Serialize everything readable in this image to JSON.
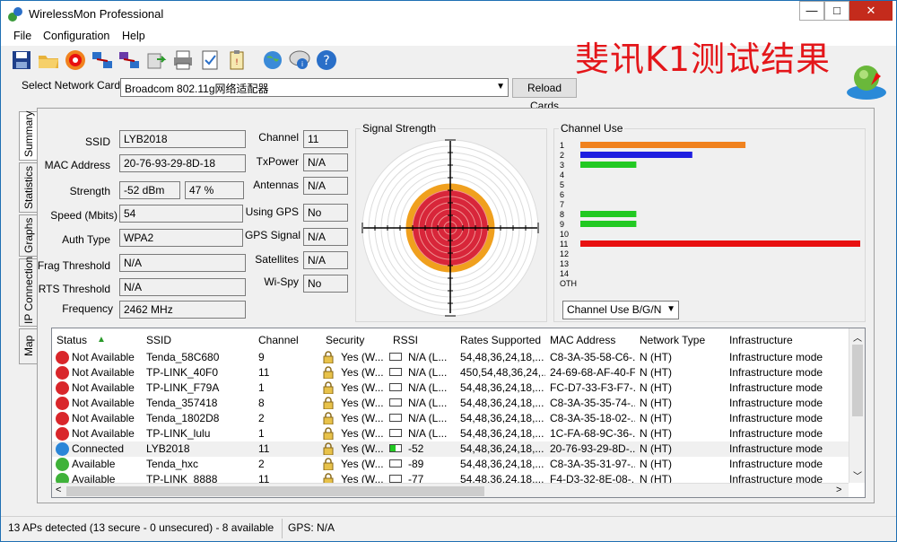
{
  "window": {
    "title": "WirelessMon Professional",
    "min_label": "—",
    "max_label": "□",
    "close_label": "✕"
  },
  "menu": [
    "File",
    "Configuration",
    "Help"
  ],
  "overlay_text": "斐讯K1测试结果",
  "network_card": {
    "label": "Select Network Card",
    "value": "Broadcom 802.11g网络适配器",
    "reload_label": "Reload Cards"
  },
  "tabs": [
    "Summary",
    "Statistics",
    "Graphs",
    "IP Connection",
    "Map"
  ],
  "summary": {
    "ssid_label": "SSID",
    "ssid": "LYB2018",
    "mac_label": "MAC Address",
    "mac": "20-76-93-29-8D-18",
    "strength_label": "Strength",
    "strength_dbm": "-52 dBm",
    "strength_pct": "47 %",
    "speed_label": "Speed (Mbits)",
    "speed": "54",
    "auth_label": "Auth Type",
    "auth": "WPA2",
    "frag_label": "Frag Threshold",
    "frag": "N/A",
    "rts_label": "RTS Threshold",
    "rts": "N/A",
    "freq_label": "Frequency",
    "freq": "2462 MHz",
    "channel_label": "Channel",
    "channel": "11",
    "txpower_label": "TxPower",
    "txpower": "N/A",
    "antennas_label": "Antennas",
    "antennas": "N/A",
    "gps_label": "Using GPS",
    "gps": "No",
    "gps_signal_label": "GPS Signal",
    "gps_signal": "N/A",
    "satellites_label": "Satellites",
    "satellites": "N/A",
    "wispy_label": "Wi-Spy",
    "wispy": "No"
  },
  "signal": {
    "title": "Signal Strength",
    "rings_total": 14,
    "rings_orange": 7,
    "rings_red": 6
  },
  "channel_use": {
    "title": "Channel Use",
    "channels": [
      "1",
      "2",
      "3",
      "4",
      "5",
      "6",
      "7",
      "8",
      "9",
      "10",
      "11",
      "12",
      "13",
      "14",
      "OTH"
    ],
    "bars": [
      {
        "channel": "1",
        "value": 0.59,
        "color": "#f0821e"
      },
      {
        "channel": "2",
        "value": 0.4,
        "color": "#1e1ee0"
      },
      {
        "channel": "3",
        "value": 0.2,
        "color": "#22c922"
      },
      {
        "channel": "8",
        "value": 0.2,
        "color": "#22c922"
      },
      {
        "channel": "9",
        "value": 0.2,
        "color": "#22c922"
      },
      {
        "channel": "11",
        "value": 1.0,
        "color": "#e81010"
      }
    ],
    "dropdown": "Channel Use B/G/N"
  },
  "list": {
    "headers": [
      "Status",
      "SSID",
      "Channel",
      "Security",
      "RSSI",
      "Rates Supported",
      "MAC Address",
      "Network Type",
      "Infrastructure"
    ],
    "rows": [
      {
        "status": "Not Available",
        "color": "#d9262b",
        "ssid": "Tenda_58C680",
        "channel": "9",
        "security": "Yes (W...",
        "rssi": "N/A (L...",
        "rates": "54,48,36,24,18,...",
        "mac": "C8-3A-35-58-C6-...",
        "type": "N (HT)",
        "infra": "Infrastructure mode",
        "sig": 0
      },
      {
        "status": "Not Available",
        "color": "#d9262b",
        "ssid": "TP-LINK_40F0",
        "channel": "11",
        "security": "Yes (W...",
        "rssi": "N/A (L...",
        "rates": "450,54,48,36,24,...",
        "mac": "24-69-68-AF-40-F0",
        "type": "N (HT)",
        "infra": "Infrastructure mode",
        "sig": 0
      },
      {
        "status": "Not Available",
        "color": "#d9262b",
        "ssid": "TP-LINK_F79A",
        "channel": "1",
        "security": "Yes (W...",
        "rssi": "N/A (L...",
        "rates": "54,48,36,24,18,...",
        "mac": "FC-D7-33-F3-F7-...",
        "type": "N (HT)",
        "infra": "Infrastructure mode",
        "sig": 0
      },
      {
        "status": "Not Available",
        "color": "#d9262b",
        "ssid": "Tenda_357418",
        "channel": "8",
        "security": "Yes (W...",
        "rssi": "N/A (L...",
        "rates": "54,48,36,24,18,...",
        "mac": "C8-3A-35-35-74-...",
        "type": "N (HT)",
        "infra": "Infrastructure mode",
        "sig": 0
      },
      {
        "status": "Not Available",
        "color": "#d9262b",
        "ssid": "Tenda_1802D8",
        "channel": "2",
        "security": "Yes (W...",
        "rssi": "N/A (L...",
        "rates": "54,48,36,24,18,...",
        "mac": "C8-3A-35-18-02-...",
        "type": "N (HT)",
        "infra": "Infrastructure mode",
        "sig": 0
      },
      {
        "status": "Not Available",
        "color": "#d9262b",
        "ssid": "TP-LINK_lulu",
        "channel": "1",
        "security": "Yes (W...",
        "rssi": "N/A (L...",
        "rates": "54,48,36,24,18,...",
        "mac": "1C-FA-68-9C-36-...",
        "type": "N (HT)",
        "infra": "Infrastructure mode",
        "sig": 0
      },
      {
        "status": "Connected",
        "color": "#2b86d8",
        "ssid": "LYB2018",
        "channel": "11",
        "security": "Yes (W...",
        "rssi": "-52",
        "rates": "54,48,36,24,18,...",
        "mac": "20-76-93-29-8D-...",
        "type": "N (HT)",
        "infra": "Infrastructure mode",
        "sig": 0.47
      },
      {
        "status": "Available",
        "color": "#3fb23a",
        "ssid": "Tenda_hxc",
        "channel": "2",
        "security": "Yes (W...",
        "rssi": "-89",
        "rates": "54,48,36,24,18,...",
        "mac": "C8-3A-35-31-97-...",
        "type": "N (HT)",
        "infra": "Infrastructure mode",
        "sig": 0
      },
      {
        "status": "Available",
        "color": "#3fb23a",
        "ssid": "TP-LINK_8888",
        "channel": "11",
        "security": "Yes (W...",
        "rssi": "-77",
        "rates": "54,48,36,24,18,...",
        "mac": "F4-D3-32-8E-08-...",
        "type": "N (HT)",
        "infra": "Infrastructure mode",
        "sig": 0
      }
    ]
  },
  "status_bar": {
    "ap_text": "13 APs detected (13 secure - 0 unsecured) - 8 available",
    "gps_text": "GPS: N/A"
  },
  "icons": [
    "save-icon",
    "open-folder-icon",
    "target-icon",
    "network-icon",
    "network-connect-icon",
    "export-icon",
    "print-icon",
    "log-icon",
    "clipboard-icon",
    "globe-icon",
    "info-bubble-icon",
    "help-icon"
  ]
}
